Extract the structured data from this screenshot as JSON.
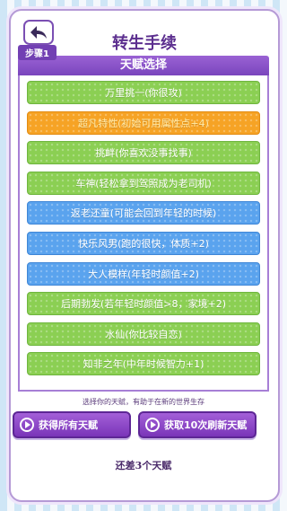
{
  "header": {
    "title": "转生手续",
    "back_icon": "back-arrow-icon"
  },
  "section": {
    "step_label": "步骤1",
    "title": "天赋选择"
  },
  "talents": [
    {
      "label": "万里挑一(你很攻)",
      "color": "green"
    },
    {
      "label": "超凡特性(初始可用属性点+4)",
      "color": "orange"
    },
    {
      "label": "挑衅(你喜欢没事找事)",
      "color": "green"
    },
    {
      "label": "车神(轻松拿到驾照成为老司机)",
      "color": "green"
    },
    {
      "label": "返老还童(可能会回到年轻的时候)",
      "color": "blue"
    },
    {
      "label": "快乐风男(跑的很快，体质+2)",
      "color": "blue"
    },
    {
      "label": "大人模样(年轻时颜值+2)",
      "color": "blue"
    },
    {
      "label": "后期勃发(若年轻时颜值>8，家境+2)",
      "color": "green"
    },
    {
      "label": "水仙(你比较自恋)",
      "color": "green"
    },
    {
      "label": "知非之年(中年时候智力+1)",
      "color": "green"
    }
  ],
  "hint": "选择你的天赋，有助于在新的世界生存",
  "buttons": {
    "get_all": "获得所有天赋",
    "refresh": "获取10次刷新天赋",
    "icon": "play-circle-icon"
  },
  "remaining": "还差3个天赋"
}
